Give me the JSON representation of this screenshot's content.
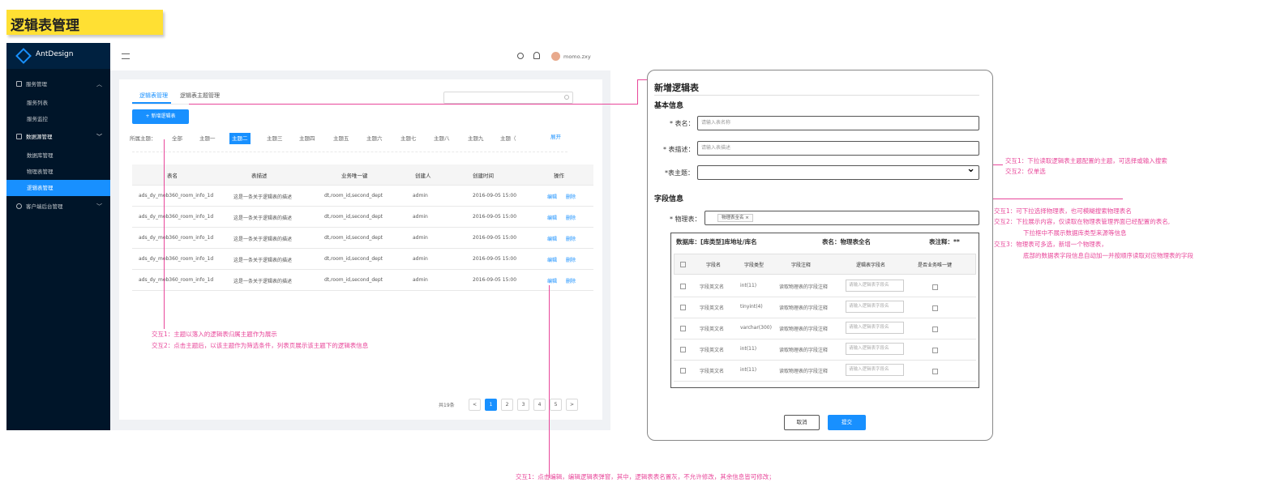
{
  "page_title": "逻辑表管理",
  "app": {
    "name": "AntDesign",
    "user": "momo.zxy"
  },
  "menu": {
    "service": "服务管理",
    "service_list": "服务列表",
    "service_monitor": "服务监控",
    "data_source": "数据源管理",
    "db_manage": "数据库管理",
    "physical": "物理表管理",
    "logical": "逻辑表管理",
    "customer": "客户端后台管理"
  },
  "tabs": [
    "逻辑表管理",
    "逻辑表主题管理"
  ],
  "add_button": "+ 新增逻辑表",
  "theme_filter": {
    "label": "所属主题：",
    "items": [
      "全部",
      "主题一",
      "主题二",
      "主题三",
      "主题四",
      "主题五",
      "主题六",
      "主题七",
      "主题八",
      "主题九",
      "主题（"
    ],
    "expand": "展开"
  },
  "table": {
    "headers": [
      "表名",
      "表描述",
      "业务唯一键",
      "创建人",
      "创建时间",
      "操作"
    ],
    "row": {
      "name": "ads_dy_mob360_room_info_1d",
      "desc": "这是一条关于逻辑表的描述",
      "key": "dt,room_id,second_dept",
      "creator": "admin",
      "time": "2016-09-05 15:00",
      "edit": "编辑",
      "delete": "删除"
    }
  },
  "pagination": {
    "total": "共19条",
    "pages": [
      "1",
      "2",
      "3",
      "4",
      "5"
    ],
    "prev": "<",
    "next": ">"
  },
  "note_left": [
    "交互1：主题以落入的逻辑表归属主题作为展示",
    "交互2：点击主题后，以该主题作为筛选条件，列表页展示该主题下的逻辑表信息"
  ],
  "note_bottom": "交互1：点击编辑，编辑逻辑表弹窗，其中，逻辑表表名置灰，不允许修改，其余信息皆可修改；",
  "dialog": {
    "title": "新增逻辑表",
    "basic": "基本信息",
    "name_label": "* 表名：",
    "name_ph": "请输入表名称",
    "desc_label": "* 表描述：",
    "desc_ph": "请输入表描述",
    "theme_label": "*表主题：",
    "theme_arrow": "⌄",
    "field_section": "字段信息",
    "phys_label": "* 物理表：",
    "phys_tag": "物理表全名",
    "info_db": "数据库：[库类型]库地址/库名",
    "info_table": "表名：物理表全名",
    "info_comment": "表注释：**",
    "columns": [
      "字段名",
      "字段类型",
      "字段注释",
      "逻辑表字段名",
      "是否业务唯一键"
    ],
    "rows": [
      {
        "name": "字段英文名",
        "type": "int(11)",
        "comment": "读取物理表的字段注释",
        "ph": "请输入逻辑表字段名"
      },
      {
        "name": "字段英文名",
        "type": "tinyint(4)",
        "comment": "读取物理表的字段注释",
        "ph": "请输入逻辑表字段名"
      },
      {
        "name": "字段英文名",
        "type": "varchar(300)",
        "comment": "读取物理表的字段注释",
        "ph": "请输入逻辑表字段名"
      },
      {
        "name": "字段英文名",
        "type": "int(11)",
        "comment": "读取物理表的字段注释",
        "ph": "请输入逻辑表字段名"
      },
      {
        "name": "字段英文名",
        "type": "int(11)",
        "comment": "读取物理表的字段注释",
        "ph": "请输入逻辑表字段名"
      }
    ],
    "cancel": "取消",
    "submit": "提交"
  },
  "note_theme": [
    "交互1：下拉读取逻辑表主题配置的主题，可选择或输入搜索",
    "交互2：仅单选"
  ],
  "note_phys": [
    "交互1：可下拉选择物理表，也可模糊搜索物理表名",
    "交互2：下拉展示内容，仅读取在物理表管理界面已经配置的表名,",
    "下拉框中不展示数据库类型来源等信息",
    "交互3：物理表可多选，新增一个物理表，",
    "底部的数据表字段信息自动加一并按顺序读取对应物理表的字段"
  ]
}
